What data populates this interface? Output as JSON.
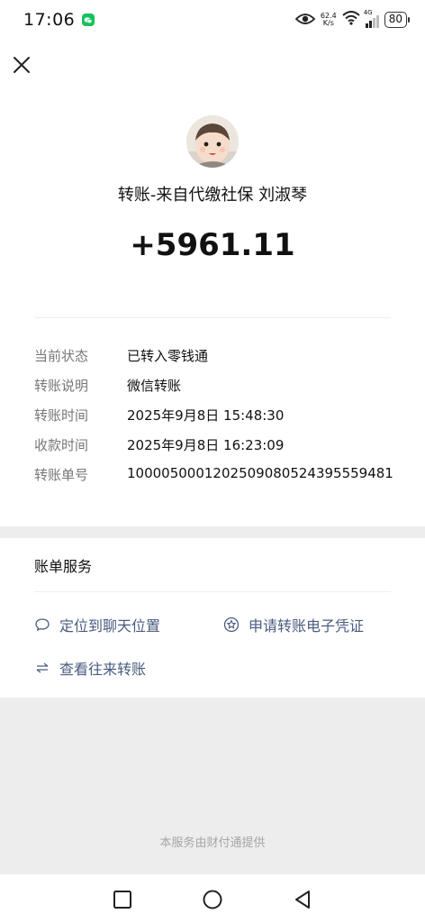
{
  "status_bar": {
    "time": "17:06",
    "net_speed_value": "62.4",
    "net_speed_unit": "K/s",
    "network_type": "4G",
    "battery": "80"
  },
  "transfer": {
    "payer_line": "转账-来自代缴社保 刘淑琴",
    "amount": "+5961.11",
    "details": [
      {
        "label": "当前状态",
        "value": "已转入零钱通"
      },
      {
        "label": "转账说明",
        "value": "微信转账"
      },
      {
        "label": "转账时间",
        "value": "2025年9月8日 15:48:30"
      },
      {
        "label": "收款时间",
        "value": "2025年9月8日 16:23:09"
      },
      {
        "label": "转账单号",
        "value": "10000500012025090805243955594​81"
      }
    ]
  },
  "services": {
    "title": "账单服务",
    "links": {
      "locate_chat": "定位到聊天位置",
      "request_voucher": "申请转账电子凭证",
      "view_transfers": "查看往来转账"
    }
  },
  "footer": {
    "provider": "本服务由财付通提供"
  },
  "colors": {
    "link": "#4a5b7f",
    "wechat_green": "#15c25a",
    "page_bg": "#ededed"
  }
}
